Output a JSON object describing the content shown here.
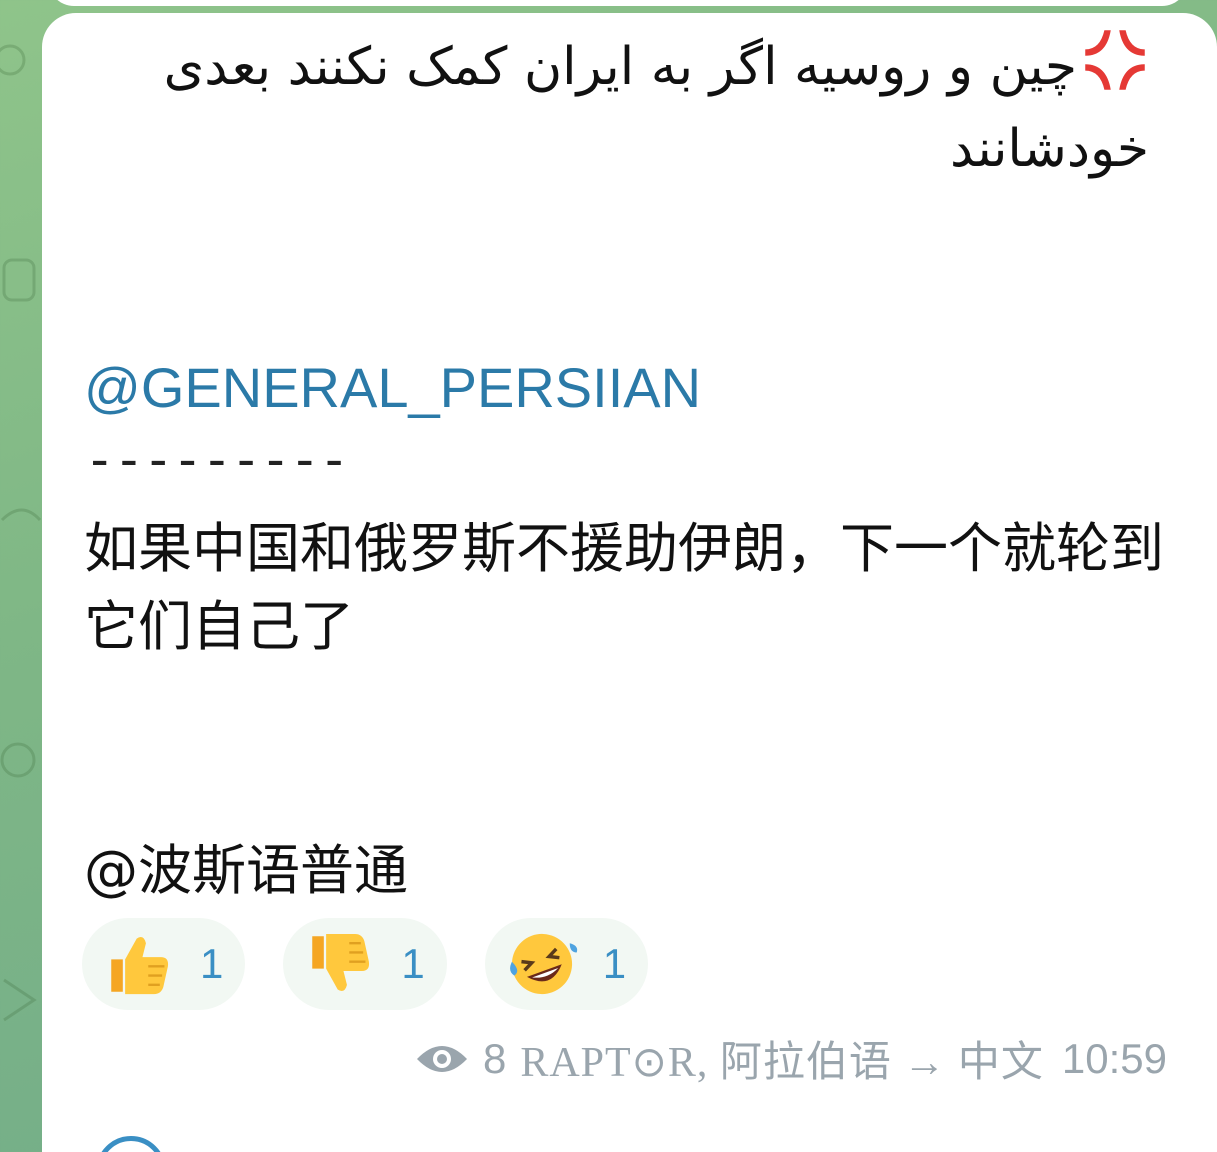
{
  "message": {
    "persian_text": "چین و روسیه اگر به ایران کمک نکنند بعدی خودشانند",
    "mention": "@GENERAL_PERSIIAN",
    "separator": "---------",
    "chinese_text": "如果中国和俄罗斯不援助伊朗，下一个就轮到它们自己了",
    "chinese_mention": "@波斯语普通",
    "reactions": [
      {
        "icon": "thumbs-up-icon",
        "count": "1"
      },
      {
        "icon": "thumbs-down-icon",
        "count": "1"
      },
      {
        "icon": "rofl-icon",
        "count": "1"
      }
    ],
    "meta": {
      "views": "8",
      "author": "RAPT⊙R, 阿拉伯语 → 中文",
      "time": "10:59"
    }
  },
  "colors": {
    "link": "#2b7aa8",
    "reaction_count": "#3a8fc4",
    "meta": "#9aa5ad",
    "background": "#7fb786"
  }
}
